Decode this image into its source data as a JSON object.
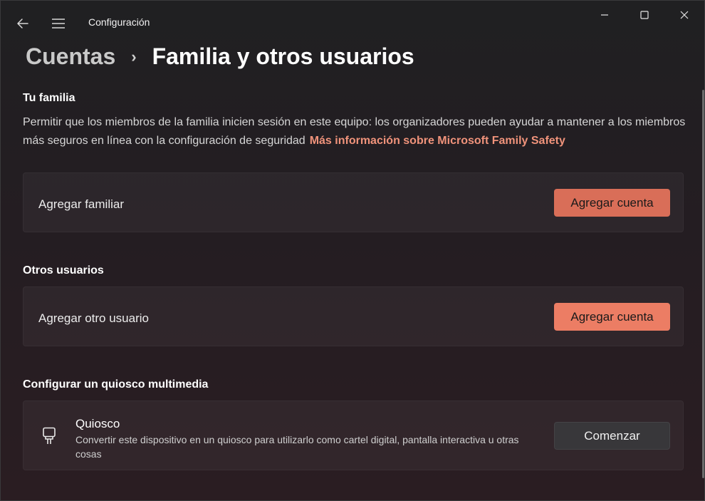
{
  "window": {
    "title": "Configuración"
  },
  "breadcrumb": {
    "parent": "Cuentas",
    "separator": "›",
    "current": "Familia y otros usuarios"
  },
  "family": {
    "heading": "Tu familia",
    "description": "Permitir que los miembros de la familia inicien sesión en este equipo: los organizadores pueden ayudar a mantener a los miembros más seguros en línea con la configuración de seguridad",
    "link": "Más información sobre Microsoft Family Safety",
    "add_member_label": "Agregar familiar",
    "add_member_button": "Agregar cuenta"
  },
  "others": {
    "heading": "Otros usuarios",
    "add_user_label": "Agregar otro usuario",
    "add_user_button": "Agregar cuenta"
  },
  "kiosk": {
    "heading": "Configurar un quiosco multimedia",
    "title": "Quiosco",
    "description": "Convertir este dispositivo en un quiosco para utilizarlo como cartel digital, pantalla interactiva u otras cosas",
    "button": "Comenzar",
    "icon": "kiosk-icon"
  },
  "colors": {
    "accent": "#ec7d64",
    "link": "#f0937b"
  }
}
